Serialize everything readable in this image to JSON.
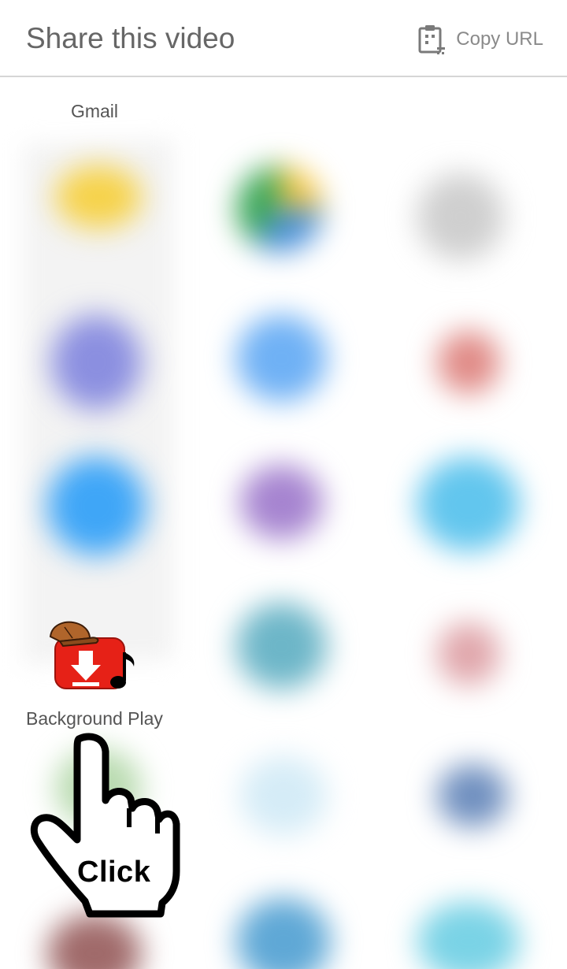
{
  "header": {
    "title": "Share this video",
    "copy_url_label": "Copy URL"
  },
  "apps": {
    "gmail_label": "Gmail",
    "background_play_label": "Background Play"
  },
  "overlay": {
    "click_text": "Click"
  },
  "colors": {
    "title_text": "#666666",
    "divider": "#d6d6d6",
    "youtube_red": "#e62117"
  },
  "icons": {
    "copy_url": "clipboard-icon",
    "background_play": "background-play-app-icon",
    "pointer": "hand-pointer-icon"
  }
}
